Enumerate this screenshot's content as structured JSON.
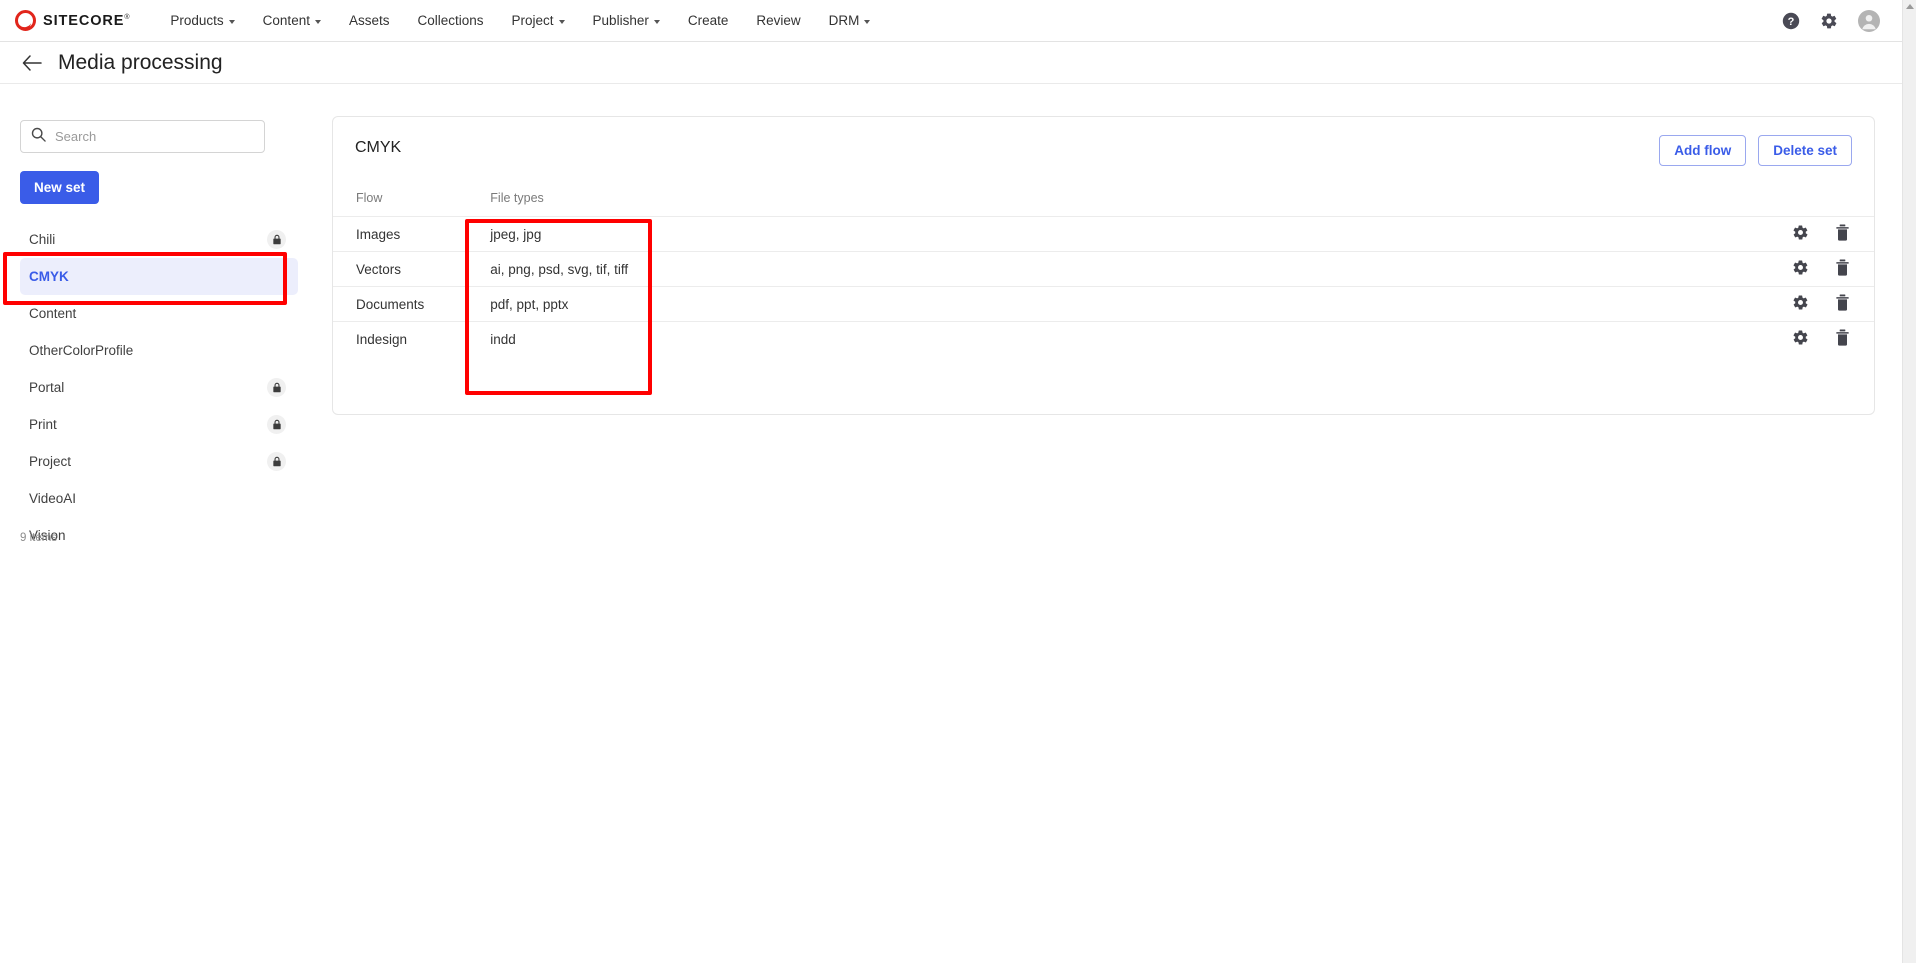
{
  "topnav": {
    "logo_text": "SITECORE",
    "items": [
      {
        "label": "Products",
        "has_caret": true
      },
      {
        "label": "Content",
        "has_caret": true
      },
      {
        "label": "Assets",
        "has_caret": false
      },
      {
        "label": "Collections",
        "has_caret": false
      },
      {
        "label": "Project",
        "has_caret": true
      },
      {
        "label": "Publisher",
        "has_caret": true
      },
      {
        "label": "Create",
        "has_caret": false
      },
      {
        "label": "Review",
        "has_caret": false
      },
      {
        "label": "DRM",
        "has_caret": true
      }
    ],
    "right_icons": [
      {
        "name": "help-icon"
      },
      {
        "name": "gear-icon"
      },
      {
        "name": "account-avatar-icon"
      }
    ]
  },
  "page": {
    "title": "Media processing",
    "back_icon": "back-arrow-icon"
  },
  "sidebar": {
    "search": {
      "placeholder": "Search",
      "value": "",
      "icon": "search-icon"
    },
    "new_set_label": "New set",
    "items": [
      {
        "label": "Chili",
        "locked": true,
        "selected": false
      },
      {
        "label": "CMYK",
        "locked": false,
        "selected": true
      },
      {
        "label": "Content",
        "locked": false,
        "selected": false
      },
      {
        "label": "OtherColorProfile",
        "locked": false,
        "selected": false
      },
      {
        "label": "Portal",
        "locked": true,
        "selected": false
      },
      {
        "label": "Print",
        "locked": true,
        "selected": false
      },
      {
        "label": "Project",
        "locked": true,
        "selected": false
      },
      {
        "label": "VideoAI",
        "locked": false,
        "selected": false
      },
      {
        "label": "Vision",
        "locked": false,
        "selected": false
      }
    ],
    "items_count": "9 items"
  },
  "card": {
    "title": "CMYK",
    "add_flow_label": "Add flow",
    "delete_set_label": "Delete set",
    "table": {
      "columns": [
        "Flow",
        "File types"
      ],
      "rows": [
        {
          "flow": "Images",
          "file_types": "jpeg, jpg"
        },
        {
          "flow": "Vectors",
          "file_types": "ai, png, psd, svg, tif, tiff"
        },
        {
          "flow": "Documents",
          "file_types": "pdf, ppt, pptx"
        },
        {
          "flow": "Indesign",
          "file_types": "indd"
        }
      ],
      "row_actions": [
        {
          "name": "settings-gear-icon"
        },
        {
          "name": "delete-trash-icon"
        }
      ]
    }
  },
  "annotations": [
    {
      "name": "highlight-selected-set",
      "color": "#ff0000"
    },
    {
      "name": "highlight-file-types-column",
      "color": "#ff0000"
    }
  ],
  "colors": {
    "brand_red": "#e1251b",
    "accent_blue": "#3a5ce8",
    "selected_bg": "#eceefc",
    "annotation_red": "#ff0000"
  }
}
